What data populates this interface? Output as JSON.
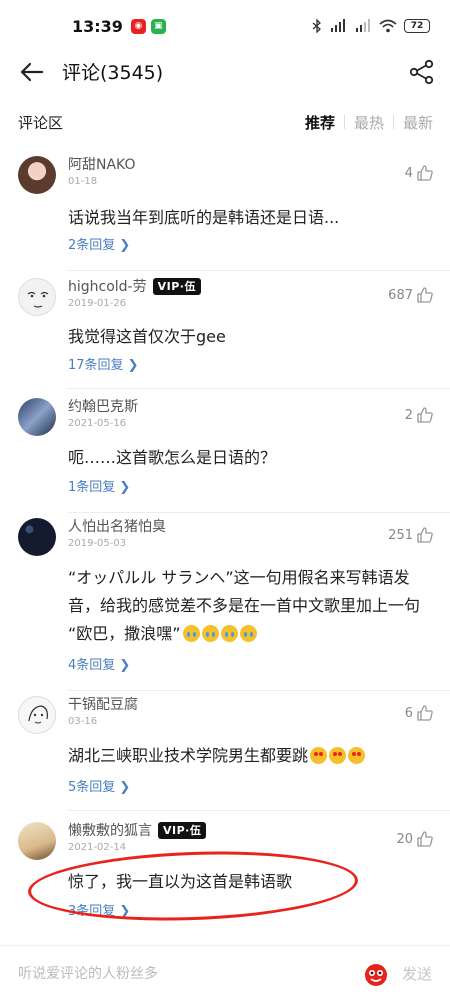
{
  "status_bar": {
    "time": "13:39",
    "battery": "72",
    "app_icons": [
      "netease-music-icon",
      "green-app-icon"
    ],
    "right_icons": [
      "bluetooth-icon",
      "signal-hd-icon",
      "signal-hd-icon",
      "wifi-icon",
      "battery-icon"
    ]
  },
  "header": {
    "title": "评论(3545)",
    "back_icon": "arrow-left-icon",
    "share_icon": "share-icon"
  },
  "section": {
    "title": "评论区",
    "sort_tabs": [
      {
        "label": "推荐",
        "active": true
      },
      {
        "label": "最热",
        "active": false
      },
      {
        "label": "最新",
        "active": false
      }
    ]
  },
  "comments": [
    {
      "name": "阿甜NAKO",
      "date": "01-18",
      "likes": "4",
      "text": "话说我当年到底听的是韩语还是日语...",
      "replies": "2条回复 ❯",
      "vip": ""
    },
    {
      "name": "highcold-劳",
      "date": "2019-01-26",
      "likes": "687",
      "text": "我觉得这首仅次于gee",
      "replies": "17条回复 ❯",
      "vip": "VIP·伍"
    },
    {
      "name": "约翰巴克斯",
      "date": "2021-05-16",
      "likes": "2",
      "text": "呃……这首歌怎么是日语的？",
      "replies": "1条回复 ❯",
      "vip": ""
    },
    {
      "name": "人怕出名猪怕臭",
      "date": "2019-05-03",
      "likes": "251",
      "text_lines": [
        "“オッパルル サランヘ”这一句用假名来写韩语发",
        "音，给我的感觉差不多是在一首中文歌里加上一句",
        "“欧巴，撒浪嘿”"
      ],
      "replies": "4条回复 ❯",
      "vip": ""
    },
    {
      "name": "干锅配豆腐",
      "date": "03-16",
      "likes": "6",
      "text": "湖北三峡职业技术学院男生都要跳",
      "replies": "5条回复 ❯",
      "vip": ""
    },
    {
      "name": "懒敷敷的狐言",
      "date": "2021-02-14",
      "likes": "20",
      "text": "惊了，我一直以为这首是韩语歌",
      "replies": "3条回复 ❯",
      "vip": "VIP·伍"
    }
  ],
  "bottom_bar": {
    "placeholder": "听说爱评论的人粉丝多",
    "send_label": "发送",
    "emoji_icon": "emoji-face-icon"
  },
  "colors": {
    "accent_red": "#e8231c",
    "reply_link": "#4a7fc1",
    "vip_badge_bg": "#111111"
  }
}
